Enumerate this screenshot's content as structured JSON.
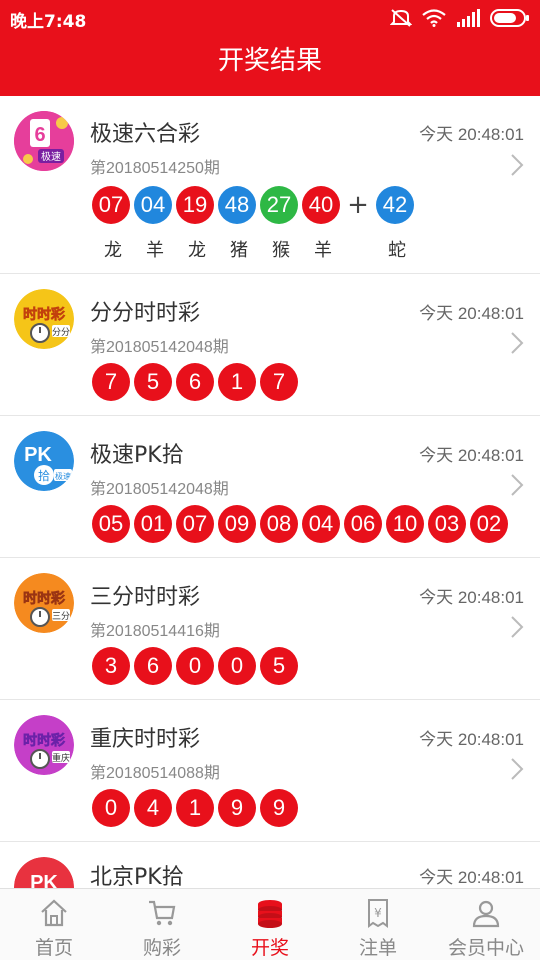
{
  "status": {
    "time": "晚上7:48"
  },
  "header": {
    "title": "开奖结果"
  },
  "rows": [
    {
      "name": "极速六合彩",
      "time": "今天 20:48:01",
      "issue": "第20180514250期",
      "balls": [
        "07",
        "04",
        "19",
        "48",
        "27",
        "40"
      ],
      "ball_colors": [
        "red",
        "blue",
        "red",
        "blue",
        "green",
        "red"
      ],
      "extra": "42",
      "extra_color": "blue",
      "zodiac": [
        "龙",
        "羊",
        "龙",
        "猪",
        "猴",
        "羊"
      ],
      "extra_zodiac": "蛇",
      "logo": {
        "icon": "six-speed-icon",
        "text": "6",
        "sub": "极速",
        "color": "#e63e9b"
      }
    },
    {
      "name": "分分时时彩",
      "time": "今天 20:48:01",
      "issue": "第201805142048期",
      "balls": [
        "7",
        "5",
        "6",
        "1",
        "7"
      ],
      "logo": {
        "icon": "ssc-yellow-icon",
        "text": "时时彩",
        "sub": "分分",
        "color": "#f5c518"
      }
    },
    {
      "name": "极速PK拾",
      "time": "今天 20:48:01",
      "issue": "第201805142048期",
      "balls": [
        "05",
        "01",
        "07",
        "09",
        "08",
        "04",
        "06",
        "10",
        "03",
        "02"
      ],
      "logo": {
        "icon": "pk10-blue-icon",
        "text": "PK",
        "sub": "拾",
        "tag": "极速",
        "color": "#2a8fe0"
      }
    },
    {
      "name": "三分时时彩",
      "time": "今天 20:48:01",
      "issue": "第20180514416期",
      "balls": [
        "3",
        "6",
        "0",
        "0",
        "5"
      ],
      "logo": {
        "icon": "ssc-orange-icon",
        "text": "时时彩",
        "sub": "三分",
        "color": "#f58a1f"
      }
    },
    {
      "name": "重庆时时彩",
      "time": "今天 20:48:01",
      "issue": "第20180514088期",
      "balls": [
        "0",
        "4",
        "1",
        "9",
        "9"
      ],
      "logo": {
        "icon": "ssc-purple-icon",
        "text": "时时彩",
        "sub": "重庆",
        "color": "#c53fc8"
      }
    },
    {
      "name": "北京PK拾",
      "time": "今天 20:48:01",
      "logo": {
        "icon": "pk10-red-icon",
        "text": "PK",
        "color": "#e8323f"
      }
    }
  ],
  "tabbar": {
    "items": [
      {
        "label": "首页",
        "icon": "home-icon"
      },
      {
        "label": "购彩",
        "icon": "cart-icon"
      },
      {
        "label": "开奖",
        "icon": "coins-icon",
        "active": true
      },
      {
        "label": "注单",
        "icon": "receipt-icon"
      },
      {
        "label": "会员中心",
        "icon": "user-icon"
      }
    ]
  },
  "colors": {
    "brand_red": "#e8101b",
    "ball_blue": "#2187dd",
    "ball_green": "#2eb845"
  }
}
